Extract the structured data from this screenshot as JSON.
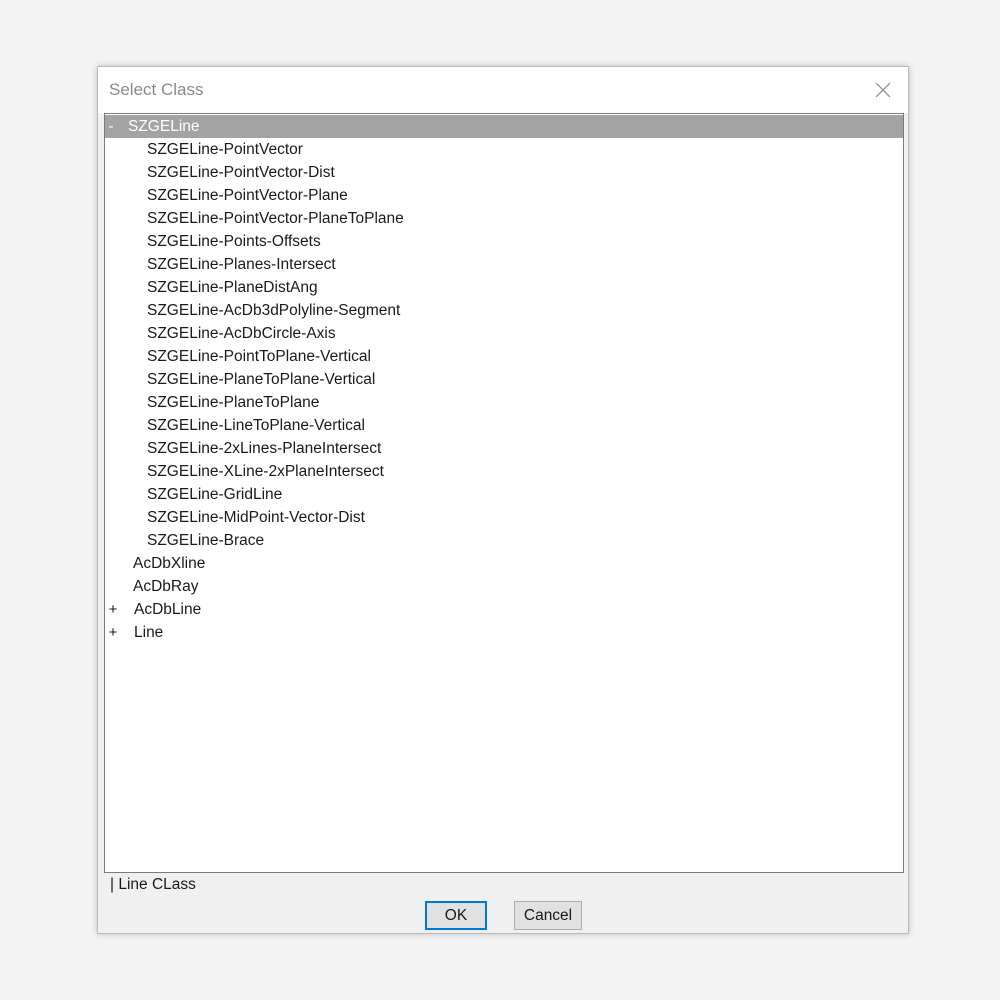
{
  "dialog": {
    "title": "Select Class",
    "close_icon": "close-icon"
  },
  "tree": {
    "root": {
      "toggle": "-",
      "label": "SZGELine",
      "children": [
        "SZGELine-PointVector",
        "SZGELine-PointVector-Dist",
        "SZGELine-PointVector-Plane",
        "SZGELine-PointVector-PlaneToPlane",
        "SZGELine-Points-Offsets",
        "SZGELine-Planes-Intersect",
        "SZGELine-PlaneDistAng",
        "SZGELine-AcDb3dPolyline-Segment",
        "SZGELine-AcDbCircle-Axis",
        "SZGELine-PointToPlane-Vertical",
        "SZGELine-PlaneToPlane-Vertical",
        "SZGELine-PlaneToPlane",
        "SZGELine-LineToPlane-Vertical",
        "SZGELine-2xLines-PlaneIntersect",
        "SZGELine-XLine-2xPlaneIntersect",
        "SZGELine-GridLine",
        "SZGELine-MidPoint-Vector-Dist",
        "SZGELine-Brace"
      ]
    },
    "siblings": [
      {
        "toggle": "",
        "label": "AcDbXline"
      },
      {
        "toggle": "",
        "label": "AcDbRay"
      },
      {
        "toggle": "+",
        "label": "AcDbLine"
      },
      {
        "toggle": "+",
        "label": "Line"
      }
    ]
  },
  "status": "| Line CLass",
  "buttons": {
    "ok": "OK",
    "cancel": "Cancel"
  },
  "colors": {
    "selection": "#a3a3a3",
    "default_button_border": "#0078d7"
  }
}
